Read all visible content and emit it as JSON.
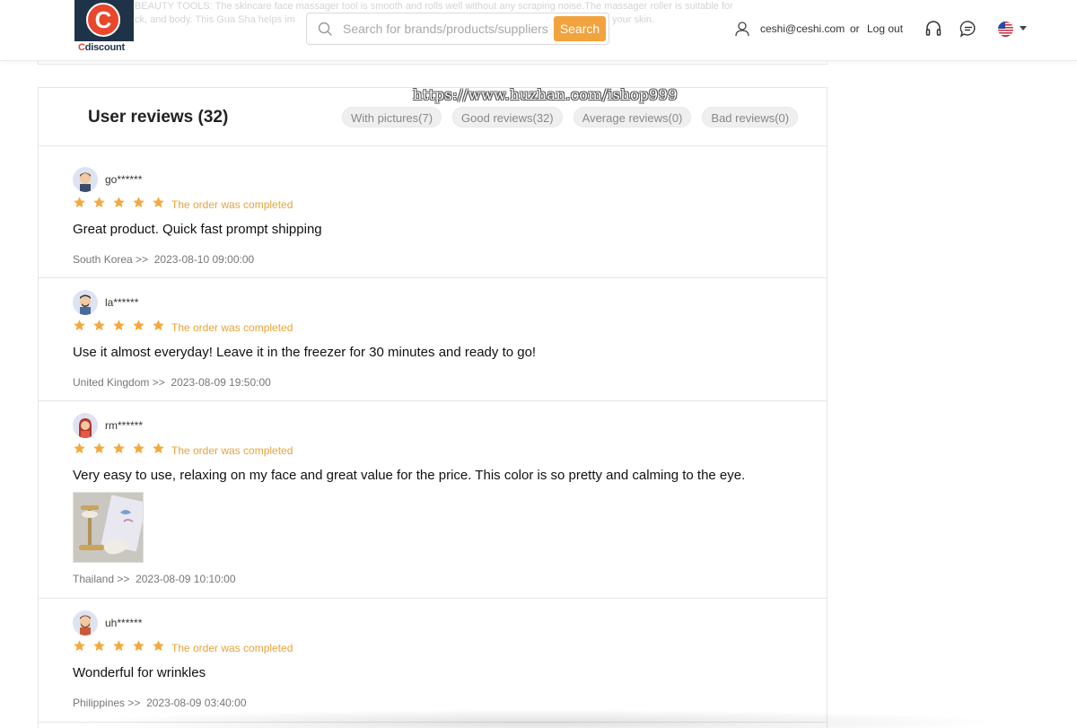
{
  "background_text": {
    "line1": "BEAUTY TOOLS: The skincare face massager tool is smooth and rolls well without any scraping noise.The massager roller is suitable for",
    "line2": "ck, and body. This Gua Sha helps im",
    "line3": "your skin."
  },
  "header": {
    "logo_text_c": "C",
    "logo_text_rest": "discount",
    "search_placeholder": "Search for brands/products/suppliers",
    "search_value": "",
    "search_button": "Search",
    "user_email": "ceshi@ceshi.com",
    "or_text": "or",
    "logout_label": "Log out",
    "icons": [
      "user-icon",
      "headset-icon",
      "chat-icon",
      "us-flag-icon"
    ],
    "accent_color": "#f1a33e"
  },
  "watermark": "https://www.huzhan.com/ishop999",
  "reviews": {
    "title": "User reviews (32)",
    "filters": [
      "With pictures(7)",
      "Good reviews(32)",
      "Average reviews(0)",
      "Bad reviews(0)"
    ],
    "items": [
      {
        "user": "go******",
        "rating": 5,
        "status": "The order was completed",
        "text": "Great product. Quick fast prompt shipping",
        "country": "South Korea >>",
        "date": "2023-08-10 09:00:00",
        "has_photo": false
      },
      {
        "user": "la******",
        "rating": 5,
        "status": "The order was completed",
        "text": "Use it almost everyday! Leave it in the freezer for 30 minutes and ready to go!",
        "country": "United Kingdom >>",
        "date": "2023-08-09 19:50:00",
        "has_photo": false
      },
      {
        "user": "rm******",
        "rating": 5,
        "status": "The order was completed",
        "text": "Very easy to use, relaxing on my face and great value for the price. This color is so pretty and calming to the eye.",
        "country": "Thailand >>",
        "date": "2023-08-09 10:10:00",
        "has_photo": true
      },
      {
        "user": "uh******",
        "rating": 5,
        "status": "The order was completed",
        "text": "Wonderful for wrinkles",
        "country": "Philippines >>",
        "date": "2023-08-09 03:40:00",
        "has_photo": false
      }
    ],
    "star_color": "#f3a93c",
    "status_color": "#e8a33a"
  }
}
